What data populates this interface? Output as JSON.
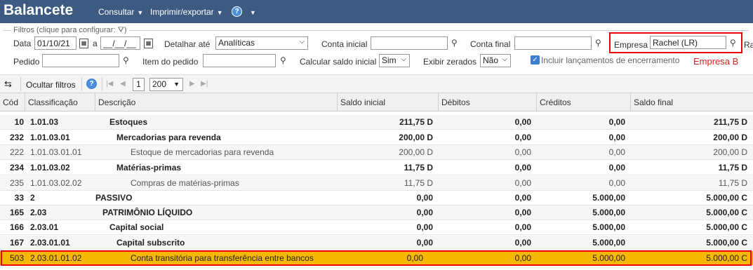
{
  "header": {
    "title": "Balancete",
    "menu": [
      {
        "label": "Consultar"
      },
      {
        "label": "Imprimir/exportar"
      }
    ]
  },
  "filters": {
    "legend": "Filtros (clique para configurar:",
    "data_label": "Data",
    "data_from": "01/10/21",
    "a_label": "a",
    "data_to": "__/__/__",
    "detalhar_label": "Detalhar até",
    "detalhar_value": "Analíticas",
    "conta_inicial_label": "Conta inicial",
    "conta_inicial_value": "",
    "conta_final_label": "Conta final",
    "conta_final_value": "",
    "empresa_label": "Empresa",
    "empresa_value": "Rachel (LR)",
    "overflow_label": "Ra",
    "pedido_label": "Pedido",
    "pedido_value": "",
    "item_pedido_label": "Item do pedido",
    "item_pedido_value": "",
    "calc_saldo_label": "Calcular saldo inicial",
    "calc_saldo_value": "Sim",
    "exibir_zerados_label": "Exibir zerados",
    "exibir_zerados_value": "Não",
    "incluir_label": "Incluir lançamentos de encerramento",
    "empresa_annotation": "Empresa B"
  },
  "toolbar": {
    "hide_filters": "Ocultar filtros",
    "page": "1",
    "page_size": "200"
  },
  "columns": [
    "Cód",
    "Classificação",
    "Descrição",
    "Saldo inicial",
    "Débitos",
    "Créditos",
    "Saldo final"
  ],
  "rows": [
    {
      "cod": "10",
      "class": "1.01.03",
      "desc": "Estoques",
      "saldo_inicial": "211,75 D",
      "debitos": "0,00",
      "creditos": "0,00",
      "saldo_final": "211,75 D"
    },
    {
      "cod": "232",
      "class": "1.01.03.01",
      "desc": "Mercadorias para revenda",
      "saldo_inicial": "200,00 D",
      "debitos": "0,00",
      "creditos": "0,00",
      "saldo_final": "200,00 D"
    },
    {
      "cod": "222",
      "class": "1.01.03.01.01",
      "desc": "Estoque de mercadorias para revenda",
      "saldo_inicial": "200,00 D",
      "debitos": "0,00",
      "creditos": "0,00",
      "saldo_final": "200,00 D"
    },
    {
      "cod": "234",
      "class": "1.01.03.02",
      "desc": "Matérias-primas",
      "saldo_inicial": "11,75 D",
      "debitos": "0,00",
      "creditos": "0,00",
      "saldo_final": "11,75 D"
    },
    {
      "cod": "235",
      "class": "1.01.03.02.02",
      "desc": "Compras de matérias-primas",
      "saldo_inicial": "11,75 D",
      "debitos": "0,00",
      "creditos": "0,00",
      "saldo_final": "11,75 D"
    },
    {
      "cod": "33",
      "class": "2",
      "desc": "PASSIVO",
      "saldo_inicial": "0,00",
      "debitos": "0,00",
      "creditos": "5.000,00",
      "saldo_final": "5.000,00 C"
    },
    {
      "cod": "165",
      "class": "2.03",
      "desc": "PATRIMÔNIO LÍQUIDO",
      "saldo_inicial": "0,00",
      "debitos": "0,00",
      "creditos": "5.000,00",
      "saldo_final": "5.000,00 C"
    },
    {
      "cod": "166",
      "class": "2.03.01",
      "desc": "Capital social",
      "saldo_inicial": "0,00",
      "debitos": "0,00",
      "creditos": "5.000,00",
      "saldo_final": "5.000,00 C"
    },
    {
      "cod": "167",
      "class": "2.03.01.01",
      "desc": "Capital subscrito",
      "saldo_inicial": "0,00",
      "debitos": "0,00",
      "creditos": "5.000,00",
      "saldo_final": "5.000,00 C"
    },
    {
      "cod": "503",
      "class": "2.03.01.01.02",
      "desc": "Conta transitória para transferência entre bancos",
      "saldo_inicial": "0,00",
      "debitos": "0,00",
      "creditos": "5.000,00",
      "saldo_final": "5.000,00 C"
    }
  ],
  "colors": {
    "topbar": "#3d5a80",
    "highlight_row": "#f6b700",
    "annotation_red": "#e00000"
  }
}
